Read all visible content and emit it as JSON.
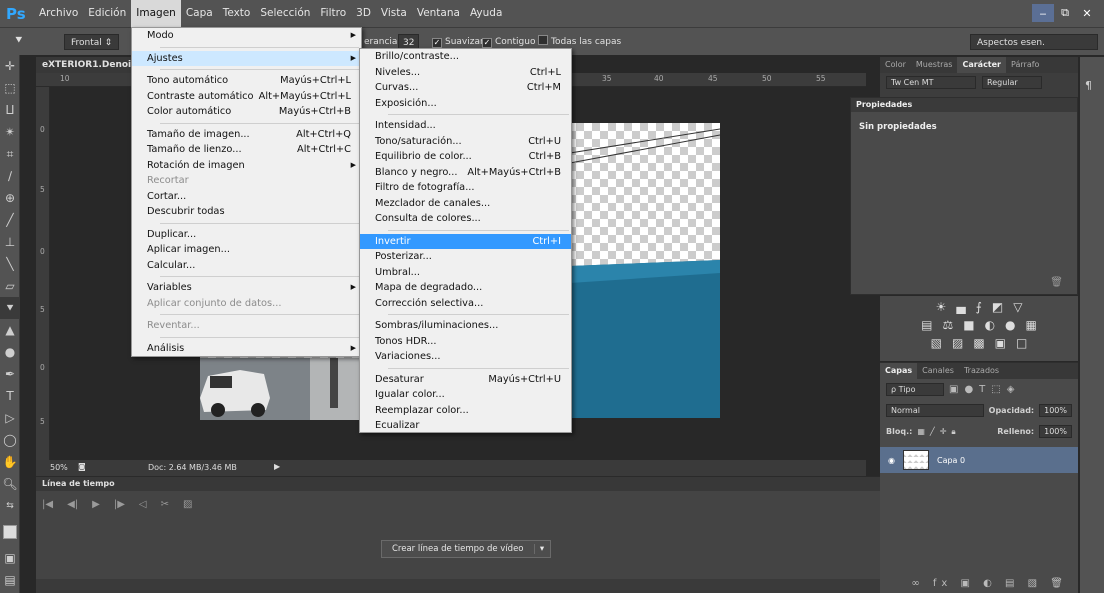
{
  "menubar": {
    "logo": "Ps",
    "items": [
      "Archivo",
      "Edición",
      "Imagen",
      "Capa",
      "Texto",
      "Selección",
      "Filtro",
      "3D",
      "Vista",
      "Ventana",
      "Ayuda"
    ],
    "active": "Imagen",
    "min": "‒",
    "max": "⧉",
    "close": "✕"
  },
  "optbar": {
    "mode_value": "Frontal",
    "tolerance_label": "erancia:",
    "tolerance_value": "32",
    "smooth": "Suavizar",
    "contiguous": "Contiguo",
    "all_layers": "Todas las capas",
    "workspace": "Aspectos esen."
  },
  "document": {
    "tab_title": "eXTERIOR1.Denoise",
    "ruler_top": [
      "10",
      "35",
      "40",
      "45",
      "50",
      "55"
    ],
    "ruler_left": [
      "0",
      "5",
      "0",
      "5",
      "0",
      "5"
    ],
    "zoom": "50%",
    "doc_info": "Doc: 2.64 MB/3.46 MB"
  },
  "timeline": {
    "title": "Línea de tiempo",
    "button": "Crear línea de tiempo de vídeo",
    "frame_label": "▯▯▯"
  },
  "character_panel": {
    "tabs": [
      "Color",
      "Muestras",
      "Carácter",
      "Párrafo"
    ],
    "active_tab": "Carácter",
    "font": "Tw Cen MT",
    "style": "Regular"
  },
  "properties_panel": {
    "title": "Propiedades",
    "body": "Sin propiedades"
  },
  "layers_panel": {
    "tabs": [
      "Capas",
      "Canales",
      "Trazados"
    ],
    "active_tab": "Capas",
    "filter": "ρ Tipo",
    "blend": "Normal",
    "opacity_label": "Opacidad:",
    "opacity_value": "100%",
    "lock_label": "Bloq.:",
    "fill_label": "Relleno:",
    "fill_value": "100%",
    "layer_name": "Capa 0"
  },
  "imagen_menu": {
    "items": [
      {
        "label": "Modo",
        "shortcut": "",
        "submenu": true
      },
      {
        "sep": true
      },
      {
        "label": "Ajustes",
        "shortcut": "",
        "submenu": true,
        "highlight": true
      },
      {
        "sep": true
      },
      {
        "label": "Tono automático",
        "shortcut": "Mayús+Ctrl+L"
      },
      {
        "label": "Contraste automático",
        "shortcut": "Alt+Mayús+Ctrl+L"
      },
      {
        "label": "Color automático",
        "shortcut": "Mayús+Ctrl+B"
      },
      {
        "sep": true
      },
      {
        "label": "Tamaño de imagen...",
        "shortcut": "Alt+Ctrl+Q"
      },
      {
        "label": "Tamaño de lienzo...",
        "shortcut": "Alt+Ctrl+C"
      },
      {
        "label": "Rotación de imagen",
        "shortcut": "",
        "submenu": true
      },
      {
        "label": "Recortar",
        "shortcut": "",
        "disabled": true
      },
      {
        "label": "Cortar...",
        "shortcut": ""
      },
      {
        "label": "Descubrir todas",
        "shortcut": ""
      },
      {
        "sep": true
      },
      {
        "label": "Duplicar...",
        "shortcut": ""
      },
      {
        "label": "Aplicar imagen...",
        "shortcut": ""
      },
      {
        "label": "Calcular...",
        "shortcut": ""
      },
      {
        "sep": true
      },
      {
        "label": "Variables",
        "shortcut": "",
        "submenu": true
      },
      {
        "label": "Aplicar conjunto de datos...",
        "shortcut": "",
        "disabled": true
      },
      {
        "sep": true
      },
      {
        "label": "Reventar...",
        "shortcut": "",
        "disabled": true
      },
      {
        "sep": true
      },
      {
        "label": "Análisis",
        "shortcut": "",
        "submenu": true
      }
    ]
  },
  "ajustes_menu": {
    "items": [
      {
        "label": "Brillo/contraste...",
        "shortcut": ""
      },
      {
        "label": "Niveles...",
        "shortcut": "Ctrl+L"
      },
      {
        "label": "Curvas...",
        "shortcut": "Ctrl+M"
      },
      {
        "label": "Exposición...",
        "shortcut": ""
      },
      {
        "sep": true
      },
      {
        "label": "Intensidad...",
        "shortcut": ""
      },
      {
        "label": "Tono/saturación...",
        "shortcut": "Ctrl+U"
      },
      {
        "label": "Equilibrio de color...",
        "shortcut": "Ctrl+B"
      },
      {
        "label": "Blanco y negro...",
        "shortcut": "Alt+Mayús+Ctrl+B"
      },
      {
        "label": "Filtro de fotografía...",
        "shortcut": ""
      },
      {
        "label": "Mezclador de canales...",
        "shortcut": ""
      },
      {
        "label": "Consulta de colores...",
        "shortcut": ""
      },
      {
        "sep": true
      },
      {
        "label": "Invertir",
        "shortcut": "Ctrl+I",
        "selected": true
      },
      {
        "label": "Posterizar...",
        "shortcut": ""
      },
      {
        "label": "Umbral...",
        "shortcut": ""
      },
      {
        "label": "Mapa de degradado...",
        "shortcut": ""
      },
      {
        "label": "Corrección selectiva...",
        "shortcut": ""
      },
      {
        "sep": true
      },
      {
        "label": "Sombras/iluminaciones...",
        "shortcut": ""
      },
      {
        "label": "Tonos HDR...",
        "shortcut": ""
      },
      {
        "label": "Variaciones...",
        "shortcut": ""
      },
      {
        "sep": true
      },
      {
        "label": "Desaturar",
        "shortcut": "Mayús+Ctrl+U"
      },
      {
        "label": "Igualar color...",
        "shortcut": ""
      },
      {
        "label": "Reemplazar color...",
        "shortcut": ""
      },
      {
        "label": "Ecualizar",
        "shortcut": ""
      }
    ]
  },
  "colors": {
    "accent": "#31a8ff",
    "menu_select": "#3399ff",
    "menu_hover": "#cde8ff",
    "wall_blue": "#1f6d90",
    "layer_selected": "#5a6f8d"
  }
}
